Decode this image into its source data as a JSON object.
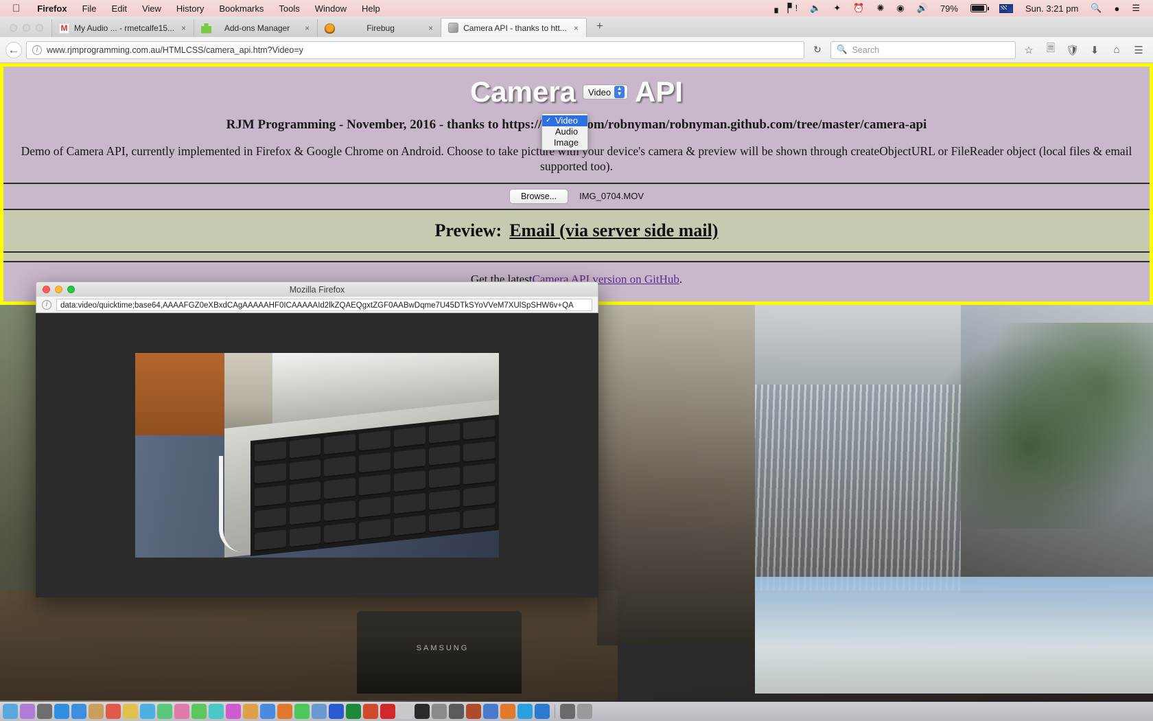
{
  "menubar": {
    "apple_icon": "apple-icon",
    "items": [
      {
        "label": "Firefox",
        "bold": true
      },
      {
        "label": "File",
        "bold": false
      },
      {
        "label": "Edit",
        "bold": false
      },
      {
        "label": "View",
        "bold": false
      },
      {
        "label": "History",
        "bold": false
      },
      {
        "label": "Bookmarks",
        "bold": false
      },
      {
        "label": "Tools",
        "bold": false
      },
      {
        "label": "Window",
        "bold": false
      },
      {
        "label": "Help",
        "bold": false
      }
    ],
    "status": {
      "equalizer_icon": "equalizer-icon",
      "airplay_icon": "airplay-icon",
      "dropbox_icon": "dropbox-icon",
      "timemachine_icon": "time-machine-icon",
      "bluetooth_icon": "bluetooth-icon",
      "wifi_icon": "wifi-icon",
      "volume_icon": "volume-icon",
      "battery_percent": "79%",
      "battery_icon": "battery-icon",
      "input_flag": "australia-flag-icon",
      "clock": "Sun. 3:21 pm",
      "spotlight_icon": "search-icon",
      "siri_icon": "siri-icon",
      "notification_icon": "notification-center-icon"
    },
    "bg_color": "#f2d3d4"
  },
  "browser": {
    "tabs": [
      {
        "title": "My Audio ... - rmetcalfe15...",
        "favicon": "gmail-icon",
        "active": false,
        "close": "×"
      },
      {
        "title": "Add-ons Manager",
        "favicon": "puzzle-icon",
        "active": false,
        "close": "×"
      },
      {
        "title": "Firebug",
        "favicon": "firebug-icon",
        "active": false,
        "close": "×"
      },
      {
        "title": "Camera API - thanks to htt...",
        "favicon": "camera-page-icon",
        "active": true,
        "close": "×"
      }
    ],
    "new_tab_label": "+",
    "back_icon": "back-arrow-icon",
    "url_scheme": "www.",
    "url_host": "rjmprogramming.com.au",
    "url_path": "/HTMLCSS/camera_api.htm?Video=y",
    "url_full": "www.rjmprogramming.com.au/HTMLCSS/camera_api.htm?Video=y",
    "reload_icon": "reload-icon",
    "search_placeholder": "Search",
    "search_value": "",
    "toolbar_icons": [
      "bookmark-star-icon",
      "reader-list-icon",
      "shield-icon",
      "downloads-icon",
      "home-icon",
      "hamburger-menu-icon"
    ]
  },
  "page": {
    "border_color": "#fcfc00",
    "bg_color": "#c9b8cb",
    "band_color": "#c8c9b1",
    "title_prefix": "Camera",
    "title_suffix": "API",
    "mode_select": {
      "value": "Video",
      "options": [
        {
          "label": "Video",
          "selected": true
        },
        {
          "label": "Audio",
          "selected": false
        },
        {
          "label": "Image",
          "selected": false
        }
      ],
      "checkmark": "✓"
    },
    "subtitle": "RJM Programming - November, 2016 - thanks to https://github.com/robnyman/robnyman.github.com/tree/master/camera-api",
    "intro": "Demo of Camera API, currently implemented in Firefox & Google Chrome on Android. Choose to take picture with your device's camera & preview will be shown through createObjectURL or FileReader object (local files & email supported too).",
    "browse_button": "Browse...",
    "file_name": "IMG_0704.MOV",
    "preview_label": "Preview:",
    "email_link": "Email (via server side mail)",
    "github_text_before": "Get the latest ",
    "github_link": "Camera API version on GitHub",
    "github_text_after": "."
  },
  "dialog": {
    "title": "Mozilla Firefox",
    "close_icon": "close-traffic-light",
    "minimize_icon": "minimize-traffic-light",
    "zoom_icon": "zoom-traffic-light",
    "info_icon": "page-info-icon",
    "url": "data:video/quicktime;base64,AAAAFGZ0eXBxdCAgAAAAAHF0ICAAAAAId2lkZQAEQgxtZGF0AABwDqme7U45DTkSYoVVeM7XUlSpSHW6v+QA",
    "video_frame_name": "video-preview"
  },
  "dock": {
    "items": [
      "finder-icon",
      "siri-icon",
      "launchpad-icon",
      "safari-icon",
      "mail-icon",
      "contacts-icon",
      "calendar-icon",
      "notes-icon",
      "reminders-icon",
      "maps-icon",
      "photos-icon",
      "messages-icon",
      "facetime-icon",
      "itunes-icon",
      "ibooks-icon",
      "appstore-icon",
      "firefox-icon",
      "chrome-icon",
      "preview-icon",
      "word-icon",
      "excel-icon",
      "powerpoint-icon",
      "filezilla-icon",
      "textedit-icon",
      "terminal-icon",
      "system-preferences-icon",
      "calculator-icon",
      "dictionary-icon",
      "quicktime-icon",
      "vlc-icon",
      "skype-icon",
      "dropbox-icon",
      "downloads-stack-icon",
      "trash-icon"
    ],
    "colors": [
      "#5aa7e0",
      "#b07cd8",
      "#6e6e6e",
      "#2f8fe0",
      "#3d8ee0",
      "#c8a05a",
      "#e05a4a",
      "#e0c14a",
      "#4ab0e0",
      "#5ac87a",
      "#e07aa8",
      "#5ac85a",
      "#4ac8c8",
      "#d05ad0",
      "#e0a04a",
      "#4a8ae0",
      "#e07a2a",
      "#4ac85a",
      "#6a9ad0",
      "#2a5ad0",
      "#1a8a3a",
      "#d04a2a",
      "#d0282a",
      "#c8c8c8",
      "#2a2a2a",
      "#8a8a8a",
      "#5a5a5a",
      "#b04a2a",
      "#4a7ad0",
      "#e07a2a",
      "#2aa0e0",
      "#2a7ad0",
      "#6a6a6a",
      "#9a9a9a"
    ]
  }
}
